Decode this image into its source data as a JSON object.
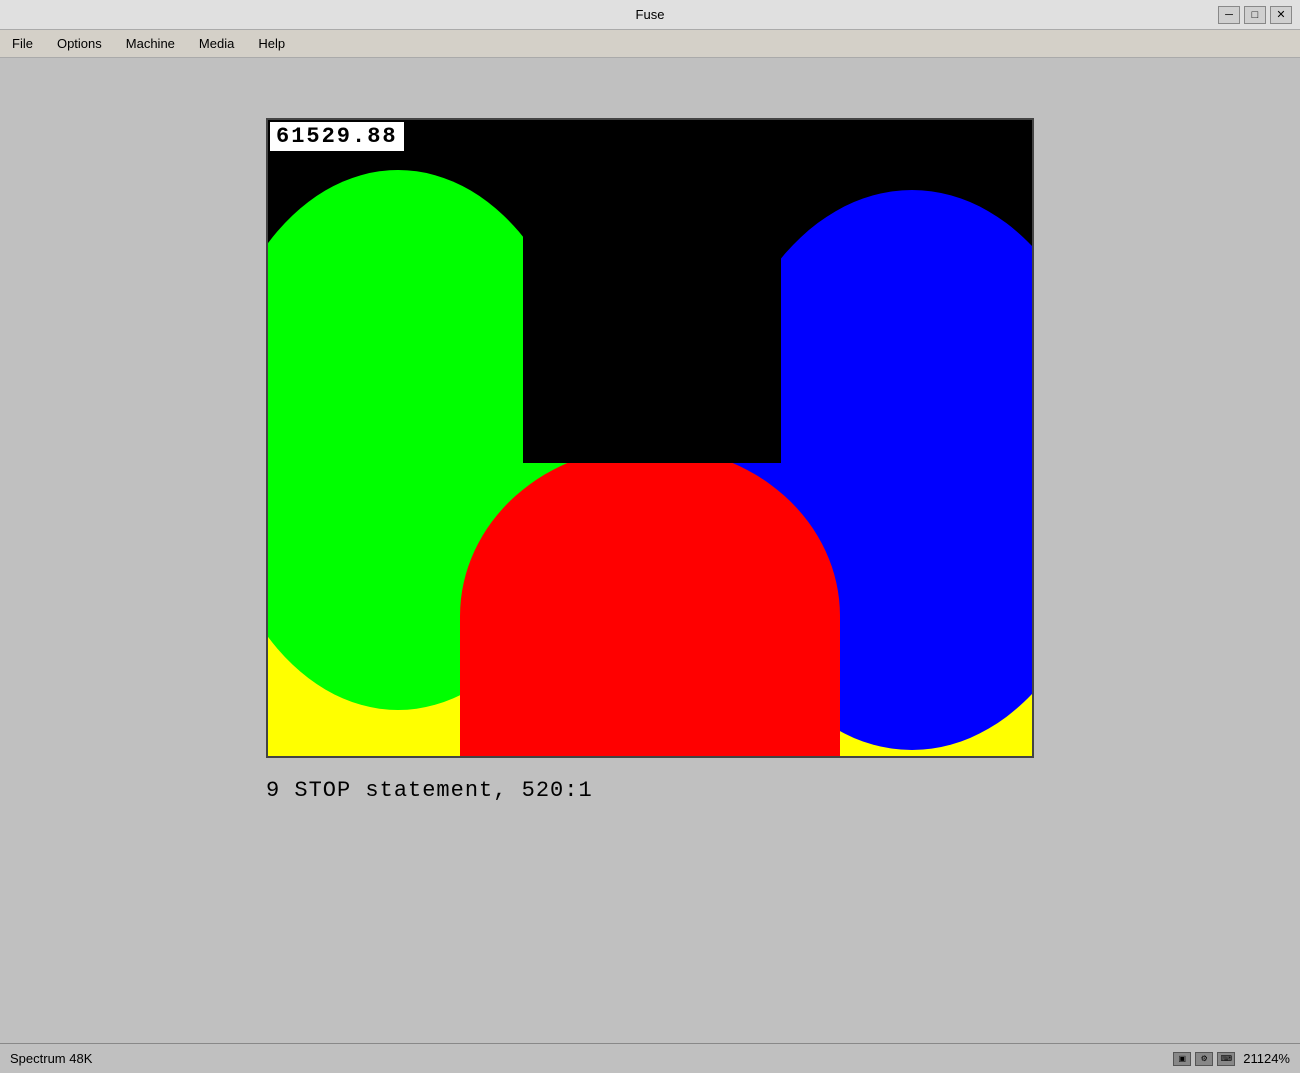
{
  "window": {
    "title": "Fuse",
    "controls": {
      "minimize": "─",
      "maximize": "□",
      "close": "✕"
    }
  },
  "menu": {
    "items": [
      "File",
      "Options",
      "Machine",
      "Media",
      "Help"
    ]
  },
  "screen": {
    "number_display": "61529.88",
    "status_message": "9 STOP statement, 520:1"
  },
  "statusbar": {
    "model": "Spectrum 48K",
    "zoom": "21124%"
  }
}
